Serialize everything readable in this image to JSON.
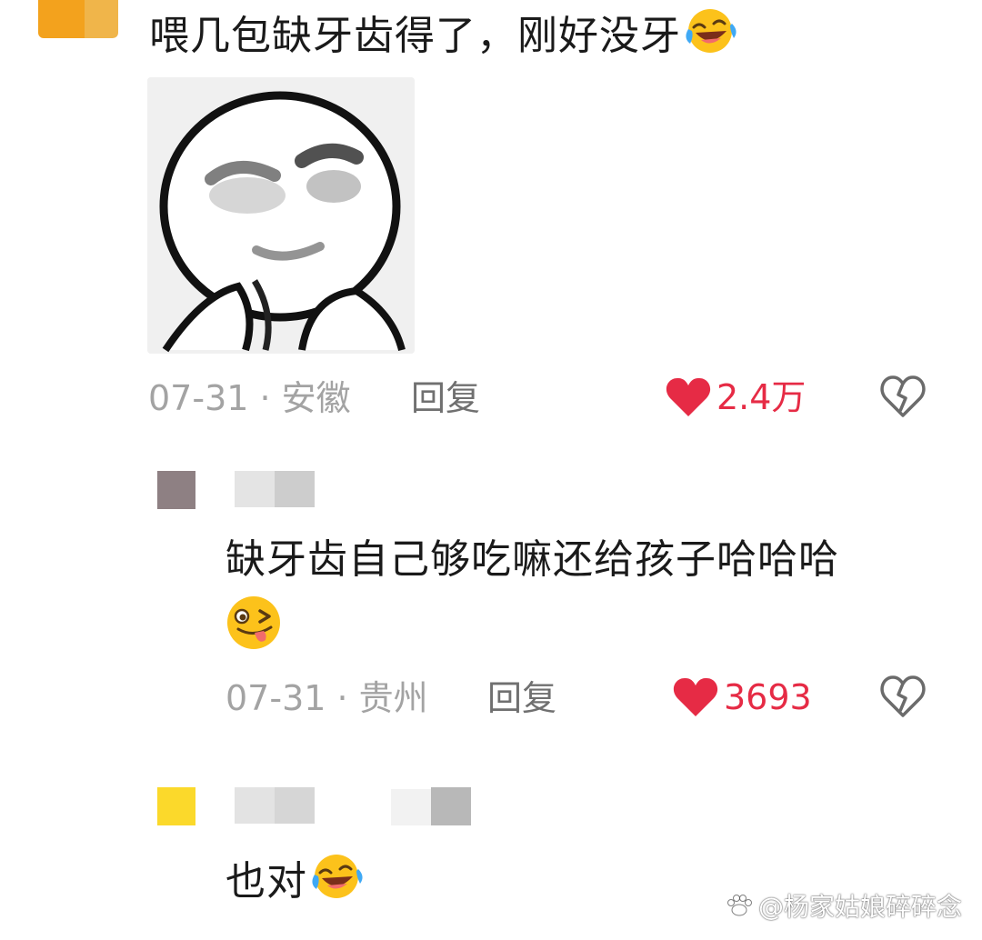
{
  "comments": [
    {
      "text": "喂几包缺牙齿得了，刚好没牙",
      "emoji": "rofl-emoji",
      "date_location": "07-31 · 安徽",
      "reply_label": "回复",
      "like_count": "2.4万",
      "sticker": "meme-face-sticker"
    },
    {
      "text_line1": "缺牙齿自己够吃嘛还给孩子哈哈哈",
      "emoji": "winking-tongue-emoji",
      "date_location": "07-31 · 贵州",
      "reply_label": "回复",
      "like_count": "3693"
    },
    {
      "text": "也对",
      "emoji": "rofl-emoji"
    }
  ],
  "watermark": "@杨家姑娘碎碎念",
  "icons": {
    "like": "heart-icon",
    "dislike": "broken-heart-icon"
  },
  "colors": {
    "like": "#e62b45",
    "meta_text": "#a3a3a3",
    "reply_text": "#707070"
  }
}
